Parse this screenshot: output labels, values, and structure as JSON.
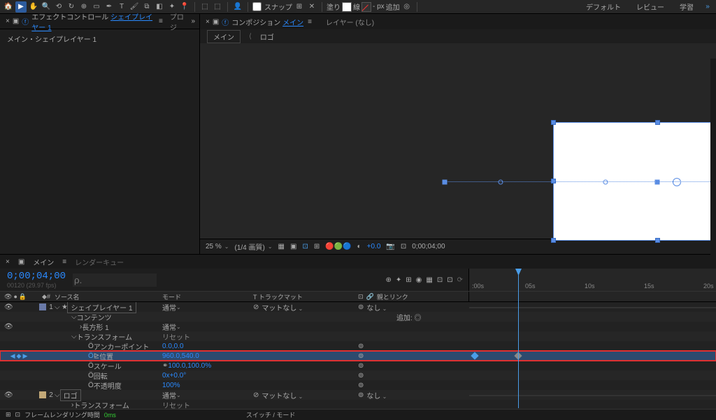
{
  "toolbar": {
    "snap": "スナップ",
    "fill": "塗り",
    "stroke": "線",
    "stroke_px": "- px",
    "add": "追加",
    "workspaces": [
      "デフォルト",
      "レビュー",
      "学習"
    ]
  },
  "left_panel": {
    "title_prefix": "エフェクトコントロール",
    "title_link": "シェイプレイヤー 1",
    "project_tab": "プロジ",
    "body": "メイン・シェイプレイヤー 1"
  },
  "comp": {
    "title_prefix": "コンポジション",
    "title_link": "メイン",
    "layer_tab": "レイヤー (なし)",
    "crumb1": "メイン",
    "crumb2": "ロゴ",
    "zoom": "25 %",
    "res": "(1/4 画質)",
    "exposure": "+0.0",
    "time": "0;00;04;00"
  },
  "tl": {
    "tab": "メイン",
    "render_tab": "レンダーキュー",
    "timecode": "0;00;04;00",
    "timecode_sub": "00120 (29.97 fps)",
    "search_ph": "ρ.",
    "headers": {
      "num": "#",
      "source": "ソース名",
      "mode": "モード",
      "track": "T トラックマット",
      "parent": "親とリンク"
    },
    "ruler": [
      ":00s",
      "05s",
      "10s",
      "15s",
      "20s"
    ],
    "layers": {
      "l1": {
        "num": "1",
        "name": "シェイプレイヤー 1",
        "mode": "通常",
        "matte": "マットなし",
        "parent": "なし"
      },
      "contents": "コンテンツ",
      "add": "追加:",
      "rect": "長方形 1",
      "rect_mode": "通常",
      "transform": "トランスフォーム",
      "reset": "リセット",
      "anchor": "アンカーポイント",
      "anchor_val": "0.0,0.0",
      "position": "位置",
      "position_val": "960.0,540.0",
      "scale": "スケール",
      "scale_val": "100.0,100.0%",
      "rotation": "回転",
      "rotation_val": "0x+0.0°",
      "opacity": "不透明度",
      "opacity_val": "100%",
      "l2": {
        "num": "2",
        "name": "ロゴ",
        "mode": "通常",
        "matte": "マットなし",
        "parent": "なし"
      },
      "l2_transform": "トランスフォーム",
      "l2_reset": "リセット"
    },
    "footer": {
      "render_time": "フレームレンダリング時間",
      "render_val": "0ms",
      "switches": "スイッチ / モード"
    }
  }
}
